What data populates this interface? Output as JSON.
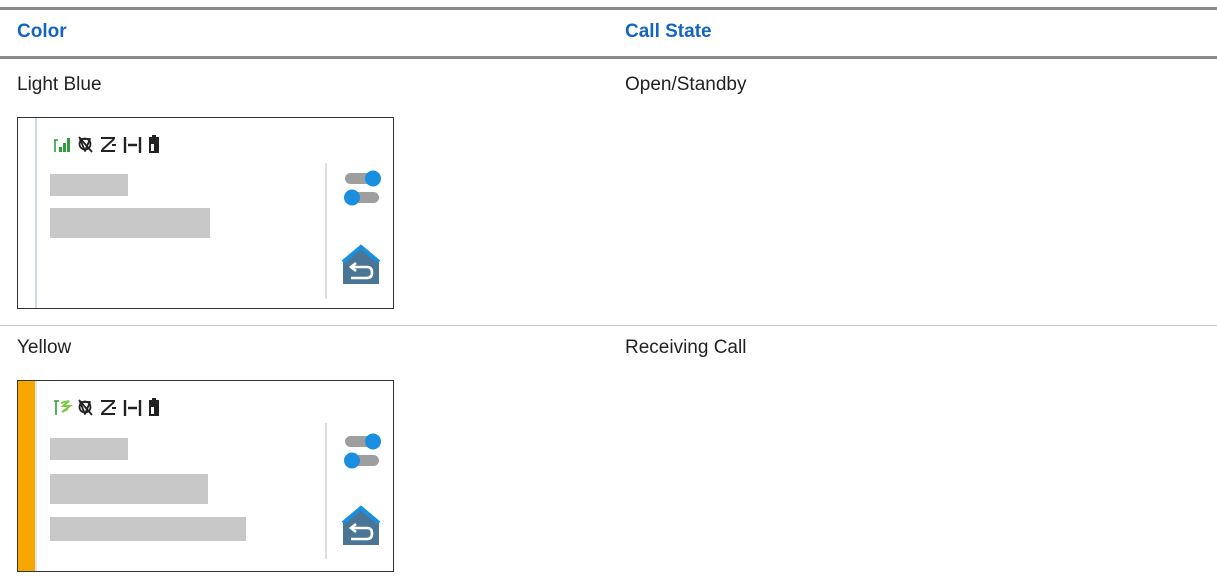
{
  "table": {
    "headers": {
      "color": "Color",
      "call_state": "Call State"
    },
    "rows": [
      {
        "color": "Light Blue",
        "state": "Open/Standby",
        "indicator_color": "#c9dbe8",
        "signal_icon": "signal-bars-icon",
        "gray_bars": 2
      },
      {
        "color": "Yellow",
        "state": "Receiving Call",
        "indicator_color": "#f6a800",
        "signal_icon": "receiving-antenna-icon",
        "gray_bars": 3
      }
    ]
  },
  "colors": {
    "header_text": "#1565c0",
    "toggle_accent": "#1a8fe0",
    "home_icon": "#4a7595",
    "signal_green": "#2e9e3a"
  }
}
